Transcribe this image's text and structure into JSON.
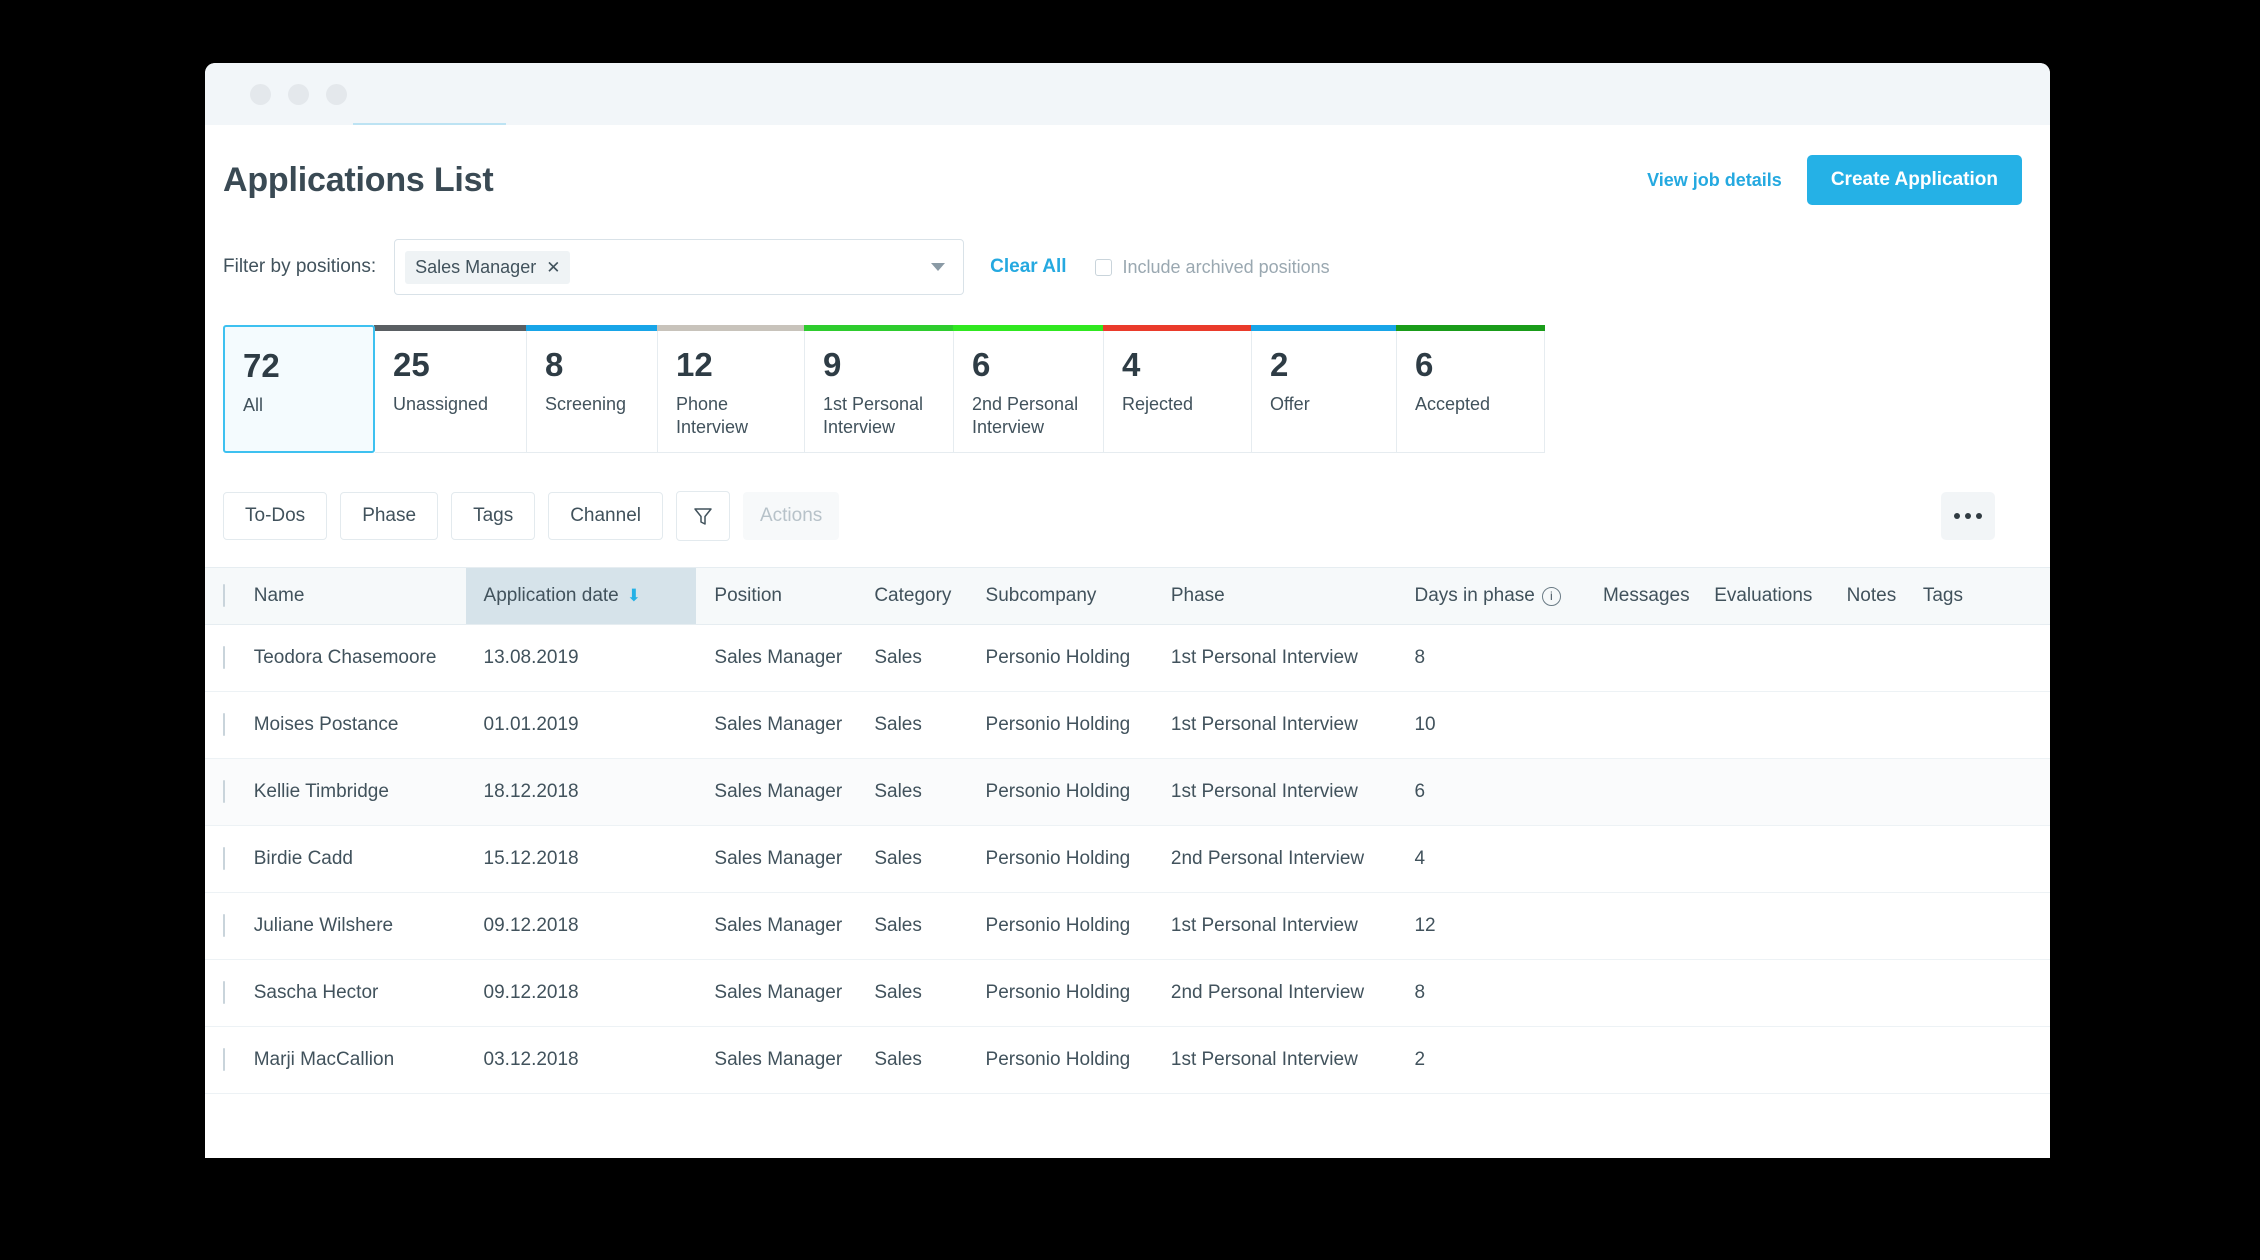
{
  "window": {
    "dots": [
      "close",
      "minimize",
      "maximize"
    ]
  },
  "header": {
    "title": "Applications List",
    "view_job_details": "View job details",
    "create_application": "Create Application"
  },
  "filter": {
    "label": "Filter by positions:",
    "chip": "Sales Manager",
    "chip_remove": "✕",
    "clear_all": "Clear All",
    "include_archived": "Include archived positions",
    "include_archived_checked": false
  },
  "cards": [
    {
      "count": "72",
      "label": "All",
      "accent": "#3ec1f0",
      "selected": true
    },
    {
      "count": "25",
      "label": "Unassigned",
      "accent": "#5a5f63",
      "selected": false
    },
    {
      "count": "8",
      "label": "Screening",
      "accent": "#18a5e8",
      "selected": false
    },
    {
      "count": "12",
      "label": "Phone Interview",
      "accent": "#c8c3bb",
      "selected": false
    },
    {
      "count": "9",
      "label": "1st Personal Interview",
      "accent": "#2ecc2e",
      "selected": false
    },
    {
      "count": "6",
      "label": "2nd Personal Interview",
      "accent": "#30e820",
      "selected": false
    },
    {
      "count": "4",
      "label": "Rejected",
      "accent": "#ea3b2b",
      "selected": false
    },
    {
      "count": "2",
      "label": "Offer",
      "accent": "#18a5e8",
      "selected": false
    },
    {
      "count": "6",
      "label": "Accepted",
      "accent": "#1a9c1a",
      "selected": false
    }
  ],
  "toolbar": {
    "todos": "To-Dos",
    "phase": "Phase",
    "tags": "Tags",
    "channel": "Channel",
    "filter_icon": "funnel-icon",
    "actions": "Actions",
    "more": "…"
  },
  "table": {
    "columns": [
      {
        "key": "checkbox",
        "label": ""
      },
      {
        "key": "name",
        "label": "Name"
      },
      {
        "key": "date",
        "label": "Application date",
        "sorted": true,
        "sort_dir": "desc"
      },
      {
        "key": "position",
        "label": "Position"
      },
      {
        "key": "category",
        "label": "Category"
      },
      {
        "key": "subcompany",
        "label": "Subcompany"
      },
      {
        "key": "phase",
        "label": "Phase"
      },
      {
        "key": "days",
        "label": "Days in phase",
        "info": true
      },
      {
        "key": "messages",
        "label": "Messages"
      },
      {
        "key": "evaluations",
        "label": "Evaluations"
      },
      {
        "key": "notes",
        "label": "Notes"
      },
      {
        "key": "tags",
        "label": "Tags"
      }
    ],
    "rows": [
      {
        "name": "Teodora Chasemoore",
        "date": "13.08.2019",
        "position": "Sales Manager",
        "category": "Sales",
        "subcompany": "Personio Holding",
        "phase": "1st Personal Interview",
        "days": "8",
        "messages": "",
        "evaluations": "",
        "notes": "",
        "tags": ""
      },
      {
        "name": "Moises Postance",
        "date": "01.01.2019",
        "position": "Sales Manager",
        "category": "Sales",
        "subcompany": "Personio Holding",
        "phase": "1st Personal Interview",
        "days": "10",
        "messages": "",
        "evaluations": "",
        "notes": "",
        "tags": ""
      },
      {
        "name": "Kellie Timbridge",
        "date": "18.12.2018",
        "position": "Sales Manager",
        "category": "Sales",
        "subcompany": "Personio Holding",
        "phase": "1st Personal Interview",
        "days": "6",
        "messages": "",
        "evaluations": "",
        "notes": "",
        "tags": ""
      },
      {
        "name": "Birdie Cadd",
        "date": "15.12.2018",
        "position": "Sales Manager",
        "category": "Sales",
        "subcompany": "Personio Holding",
        "phase": "2nd Personal Interview",
        "days": "4",
        "messages": "",
        "evaluations": "",
        "notes": "",
        "tags": ""
      },
      {
        "name": "Juliane Wilshere",
        "date": "09.12.2018",
        "position": "Sales Manager",
        "category": "Sales",
        "subcompany": "Personio Holding",
        "phase": "1st Personal Interview",
        "days": "12",
        "messages": "",
        "evaluations": "",
        "notes": "",
        "tags": ""
      },
      {
        "name": "Sascha Hector",
        "date": "09.12.2018",
        "position": "Sales Manager",
        "category": "Sales",
        "subcompany": "Personio Holding",
        "phase": "2nd Personal Interview",
        "days": "8",
        "messages": "",
        "evaluations": "",
        "notes": "",
        "tags": ""
      },
      {
        "name": "Marji MacCallion",
        "date": "03.12.2018",
        "position": "Sales Manager",
        "category": "Sales",
        "subcompany": "Personio Holding",
        "phase": "1st Personal Interview",
        "days": "2",
        "messages": "",
        "evaluations": "",
        "notes": "",
        "tags": ""
      }
    ]
  },
  "colors": {
    "accent": "#25b1e6",
    "link": "#25a9e0",
    "text": "#41525c",
    "title": "#3a4a54",
    "header_bg": "#f6f9fa",
    "sorted_bg": "#d6e3ea"
  }
}
